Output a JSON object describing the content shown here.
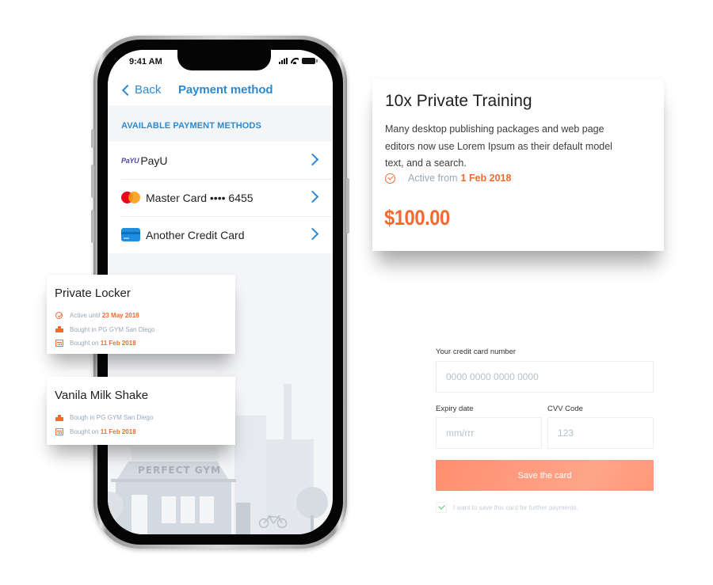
{
  "phone": {
    "status_bar": {
      "time": "9:41 AM",
      "icons": [
        "signal-icon",
        "wifi-icon",
        "battery-icon"
      ]
    },
    "nav": {
      "back_label": "Back",
      "title": "Payment method"
    },
    "section_title": "AVAILABLE PAYMENT METHODS",
    "payment_methods": [
      {
        "logo": "payu-logo",
        "logo_text": "PayU",
        "label": "PayU"
      },
      {
        "logo": "mastercard-logo",
        "label": "Master Card •••• 6455"
      },
      {
        "logo": "credit-card-icon",
        "label": "Another Credit Card"
      }
    ],
    "illustration": {
      "sign_text": "PERFECT GYM"
    }
  },
  "training_card": {
    "title": "10x Private Training",
    "description": "Many desktop publishing packages and web page editors now use Lorem Ipsum as their default model text, and a search.",
    "active_prefix": "Active from",
    "active_date": "1 Feb 2018",
    "price": "$100.00"
  },
  "locker_card": {
    "title": "Private Locker",
    "lines": [
      {
        "icon": "check-circle-icon",
        "prefix": "Active until",
        "highlight": "23 May 2018"
      },
      {
        "icon": "building-icon",
        "prefix": "Bought in PG GYM San Diego",
        "highlight": ""
      },
      {
        "icon": "calendar-icon",
        "prefix": "Bought on",
        "highlight": "11 Feb 2018"
      }
    ]
  },
  "shake_card": {
    "title": "Vanila Milk Shake",
    "lines": [
      {
        "icon": "building-icon",
        "prefix": "Bough in PG GYM San Diego",
        "highlight": ""
      },
      {
        "icon": "calendar-icon",
        "prefix": "Bought on",
        "highlight": "11 Feb 2018"
      }
    ]
  },
  "card_form": {
    "card_number_label": "Your credit card number",
    "card_number_placeholder": "0000 0000 0000 0000",
    "expiry_label": "Expiry date",
    "expiry_placeholder": "mm/rrr",
    "cvv_label": "CVV Code",
    "cvv_placeholder": "123",
    "save_button": "Save the card",
    "save_checkbox_label": "I want to save this card for further payments.",
    "save_checkbox_checked": true
  },
  "colors": {
    "ios_blue": "#2d8ad0",
    "accent_orange": "#f26a2e",
    "button_salmon": "#ffa58a",
    "check_green": "#4cbf6b"
  }
}
